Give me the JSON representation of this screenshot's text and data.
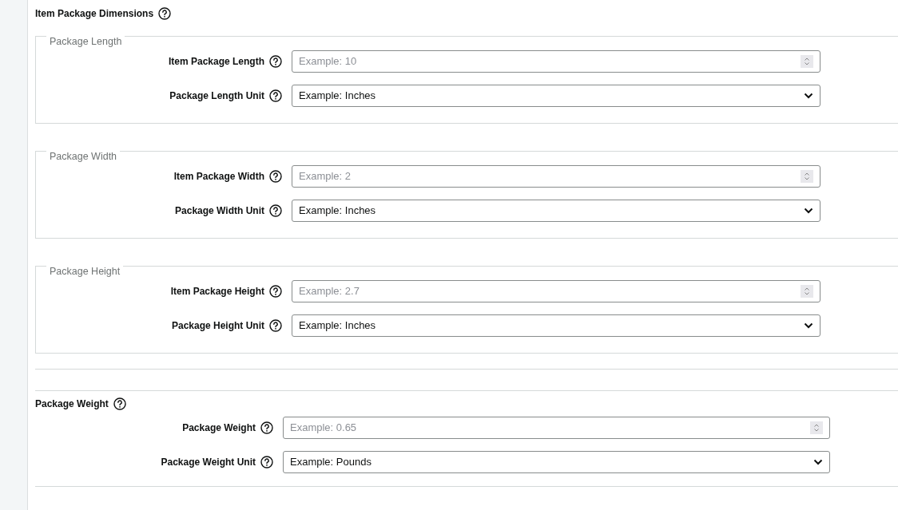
{
  "section": {
    "title": "Item Package Dimensions"
  },
  "groups": [
    {
      "legend": "Package Length",
      "rows": [
        {
          "kind": "number",
          "label": "Item Package Length",
          "placeholder": "Example: 10"
        },
        {
          "kind": "select",
          "label": "Package Length Unit",
          "value": "Example: Inches"
        }
      ]
    },
    {
      "legend": "Package Width",
      "rows": [
        {
          "kind": "number",
          "label": "Item Package Width",
          "placeholder": "Example: 2"
        },
        {
          "kind": "select",
          "label": "Package Width Unit",
          "value": "Example: Inches"
        }
      ]
    },
    {
      "legend": "Package Height",
      "rows": [
        {
          "kind": "number",
          "label": "Item Package Height",
          "placeholder": "Example: 2.7"
        },
        {
          "kind": "select",
          "label": "Package Height Unit",
          "value": "Example: Inches"
        }
      ]
    }
  ],
  "weight": {
    "title": "Package Weight",
    "rows": [
      {
        "kind": "number",
        "label": "Package Weight",
        "placeholder": "Example: 0.65"
      },
      {
        "kind": "select",
        "label": "Package Weight Unit",
        "value": "Example: Pounds"
      }
    ]
  }
}
